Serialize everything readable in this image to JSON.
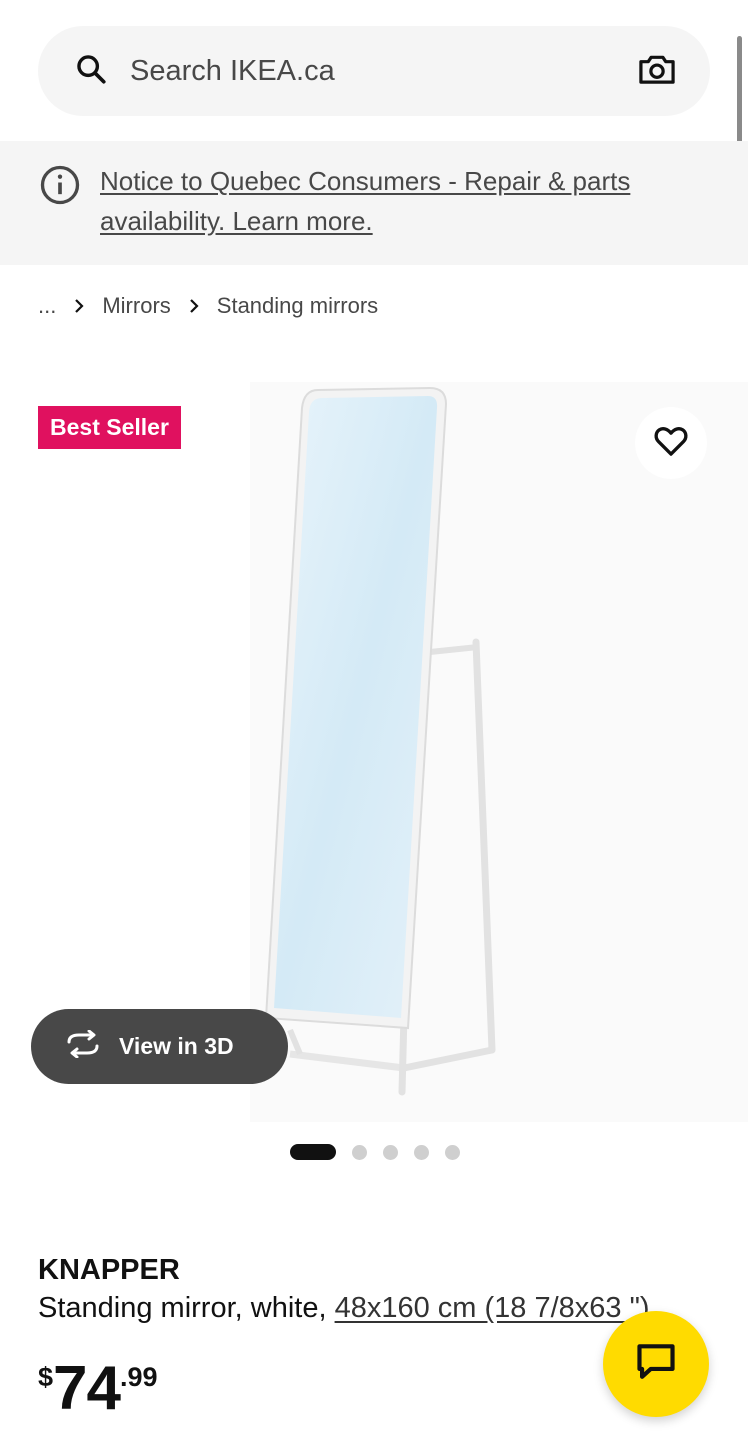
{
  "search": {
    "placeholder": "Search IKEA.ca",
    "icon": "search-icon",
    "camera_icon": "camera-icon"
  },
  "notice": {
    "text": "Notice to Quebec Consumers - Repair & parts availability. Learn more.",
    "icon": "info-icon"
  },
  "breadcrumb": {
    "ellipsis": "...",
    "items": [
      "Mirrors",
      "Standing mirrors"
    ]
  },
  "gallery": {
    "badge": "Best Seller",
    "badge_color": "#e0115f",
    "view3d_label": "View in 3D",
    "image_count": 5,
    "active_index": 0
  },
  "product": {
    "name": "KNAPPER",
    "description": "Standing mirror, white, ",
    "size": "48x160 cm (18 7/8x63 \")",
    "price": {
      "currency": "$",
      "integer": "74",
      "decimal": ".99"
    }
  },
  "chat": {
    "icon": "chat-icon",
    "color": "#ffdb00"
  }
}
